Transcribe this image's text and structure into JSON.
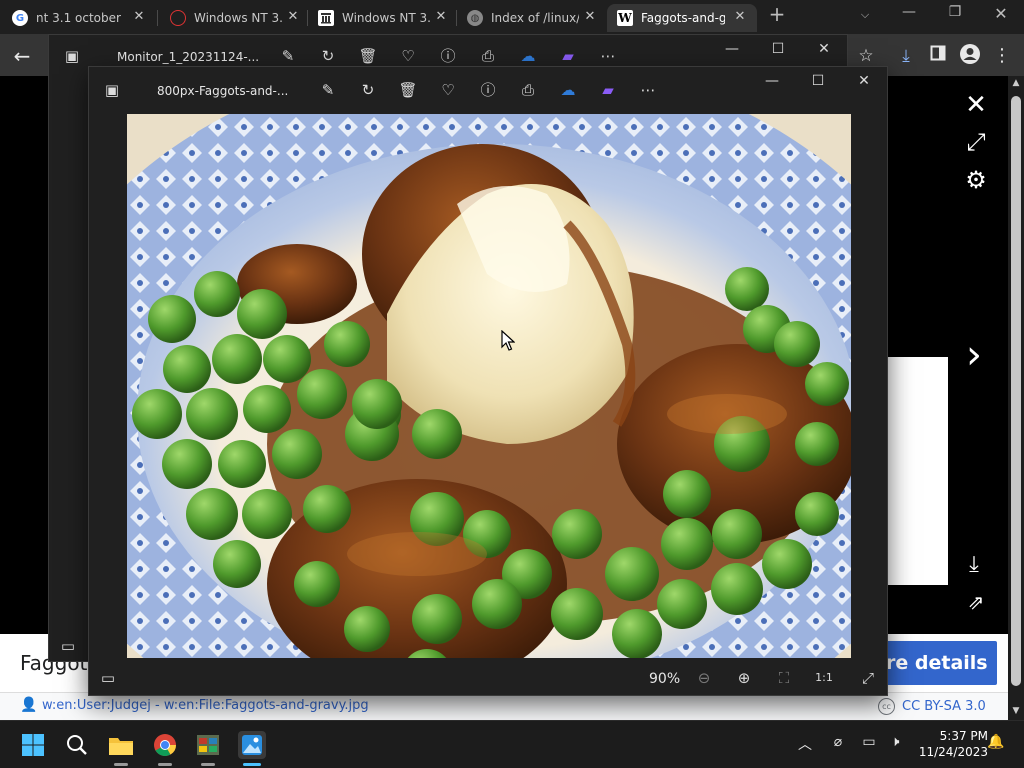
{
  "browser": {
    "tabs": [
      {
        "title": "nt 3.1 october",
        "favicon": "google-icon",
        "active": false
      },
      {
        "title": "Windows NT 3.",
        "favicon": "red-logo-icon",
        "active": false
      },
      {
        "title": "Windows NT 3.",
        "favicon": "archive-icon",
        "active": false
      },
      {
        "title": "Index of /linux/",
        "favicon": "globe-icon",
        "active": false
      },
      {
        "title": "Faggots-and-g",
        "favicon": "wikipedia-icon",
        "active": true
      }
    ],
    "favicon_letter_w": "W",
    "favicon_letter_g": "G"
  },
  "wiki_page": {
    "title_partial": "Faggots",
    "more_details_label": "re details",
    "credit": "w:en:User:Judgej - w:en:File:Faggots-and-gravy.jpg",
    "license": "CC BY-SA 3.0",
    "cc_badge": "cc"
  },
  "photos_back": {
    "title": "Monitor_1_20231124-..."
  },
  "photos_front": {
    "title": "800px-Faggots-and-...",
    "zoom": "90%"
  },
  "taskbar": {
    "time": "5:37 PM",
    "date": "11/24/2023"
  },
  "colors": {
    "wiki_blue": "#3366cc",
    "accent": "#4cc2ff"
  }
}
